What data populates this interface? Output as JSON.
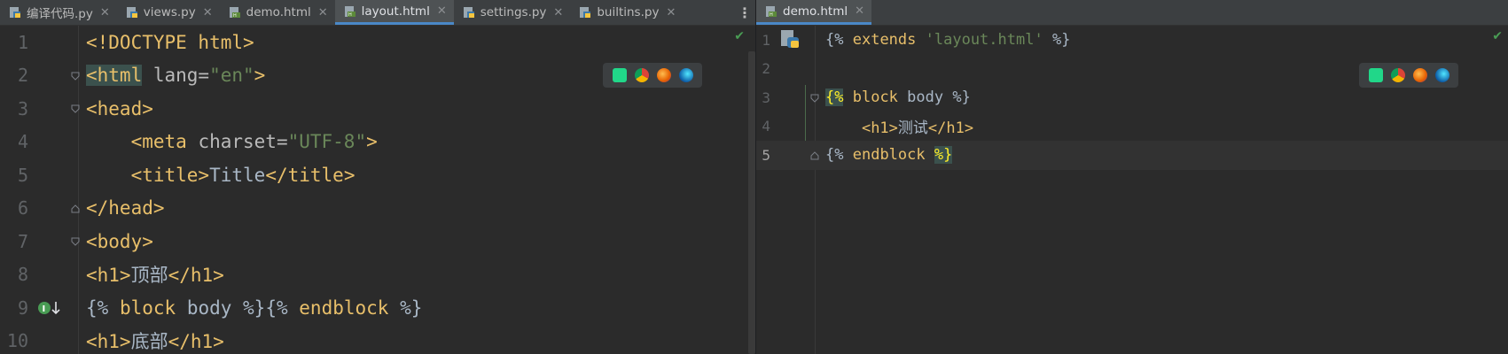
{
  "left_editor": {
    "tabs": [
      {
        "label": "编译代码.py",
        "icon": "python-file-icon",
        "active": false
      },
      {
        "label": "views.py",
        "icon": "python-file-icon",
        "active": false
      },
      {
        "label": "demo.html",
        "icon": "html-file-icon",
        "active": false
      },
      {
        "label": "layout.html",
        "icon": "html-file-icon",
        "active": true
      },
      {
        "label": "settings.py",
        "icon": "python-file-icon",
        "active": false
      },
      {
        "label": "builtins.py",
        "icon": "python-file-icon",
        "active": false
      }
    ],
    "line_numbers": [
      "1",
      "2",
      "3",
      "4",
      "5",
      "6",
      "7",
      "8",
      "9",
      "10"
    ],
    "lines": [
      {
        "text": "<!DOCTYPE html>"
      },
      {
        "text": "<html lang=\"en\">"
      },
      {
        "text": "<head>"
      },
      {
        "text": "    <meta charset=\"UTF-8\">"
      },
      {
        "text": "    <title>Title</title>"
      },
      {
        "text": "</head>"
      },
      {
        "text": "<body>"
      },
      {
        "text": "<h1>顶部</h1>"
      },
      {
        "text": "{% block body %}{% endblock %}"
      },
      {
        "text": "<h1>底部</h1>"
      }
    ]
  },
  "right_editor": {
    "tabs": [
      {
        "label": "demo.html",
        "icon": "html-file-icon",
        "active": true
      }
    ],
    "line_numbers": [
      "1",
      "2",
      "3",
      "4",
      "5"
    ],
    "lines": [
      {
        "text": "{% extends 'layout.html' %}"
      },
      {
        "text": ""
      },
      {
        "text": "{% block body %}"
      },
      {
        "text": "    <h1>测试</h1>"
      },
      {
        "text": "{% endblock %}"
      }
    ]
  },
  "browser_icons": [
    "pycharm-icon",
    "chrome-icon",
    "firefox-icon",
    "edge-icon"
  ],
  "colors": {
    "background": "#2b2b2b",
    "tag": "#e8bf6a",
    "string": "#6a8759",
    "active_tab_underline": "#4a88c7",
    "check": "#499c54"
  }
}
